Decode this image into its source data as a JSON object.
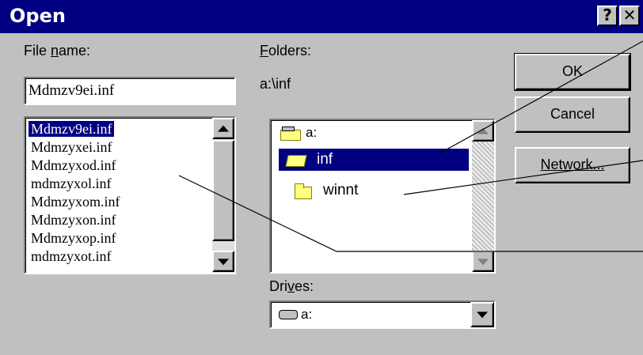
{
  "dialog": {
    "title": "Open",
    "help_glyph": "?",
    "close_glyph": "✕"
  },
  "file_name": {
    "label_pre": "File ",
    "label_key": "n",
    "label_post": "ame:",
    "value": "Mdmzv9ei.inf"
  },
  "files": {
    "items": [
      "Mdmzv9ei.inf",
      "Mdmzyxei.inf",
      "Mdmzyxod.inf",
      "mdmzyxol.inf",
      "Mdmzyxom.inf",
      "Mdmzyxon.inf",
      "Mdmzyxop.inf",
      "mdmzyxot.inf"
    ],
    "selected_index": 0
  },
  "folders": {
    "label_key": "F",
    "label_post": "olders:",
    "current_path": "a:\\inf",
    "items": [
      {
        "label": "a:",
        "icon": "drive-folder-icon"
      },
      {
        "label": "inf",
        "icon": "open-folder-icon",
        "selected": true
      },
      {
        "label": "winnt",
        "icon": "closed-folder-icon"
      }
    ]
  },
  "drives": {
    "label_pre": "Dri",
    "label_key": "v",
    "label_post": "es:",
    "value": "a:",
    "icon": "floppy-drive-icon"
  },
  "buttons": {
    "ok": "OK",
    "cancel": "Cancel",
    "network": "Network..."
  },
  "colors": {
    "title_bar": "#000080",
    "dialog_face": "#c0c0c0",
    "selection": "#000080"
  }
}
